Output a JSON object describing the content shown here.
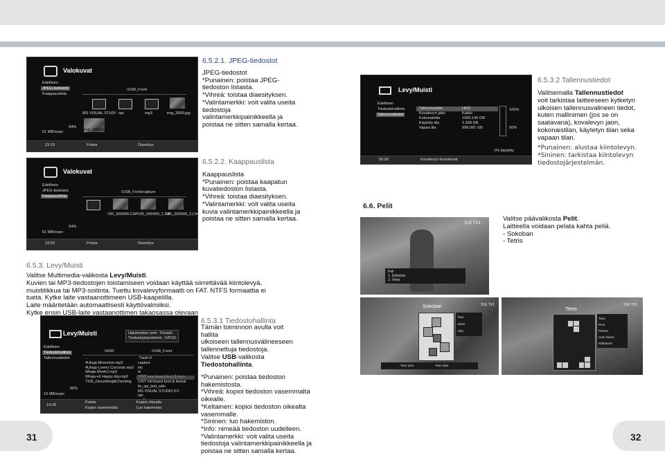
{
  "left": {
    "s1_heading": "6.5.2.1. JPEG-tiedostot",
    "s1_text": "JPEG-tiedostot\n*Punainen: poistaa JPEG-\ntiedoston listasta.\n*Vihreä: toistaa diaesityksen.\n*Valintamerkki: voit valita useita\ntiedostoja\nvalintamerkkipainikkeella ja\npoistaa ne sitten samalla kertaa.",
    "s2_heading": "6.5.2.2. Kaappauslista",
    "s2_text": "Kaappauslista\n*Punainen: poistaa kaapatun\nkuvatiedoston listasta.\n*Vihreä: toistaa diaesityksen.\n*Valintamerkki: voit valita useita\nkuvia valintamerkkipainikkeella ja\npoistaa ne sitten samalla kertaa.",
    "s3_heading": "6.5.3. Levy/Muisti",
    "s3_l1_pre": "Valitse Multimedia-valikosta ",
    "s3_l1_bold": "Levy/Muisti",
    "s3_l1_post": ".",
    "s3_rest": "Kuvien tai MP3-tiedostojen toistamiseen voidaan käyttää siirrettävää kiintolevyä,\nmuistitikkua tai MP3-soitinta. Tuettu kovalevyformaatti on FAT. NTFS formaattia ei\ntueta. Kytke laite vastaanottimeen USB-kaapelilla.\nLaite määritetään automaattisesti käyttövalmiiksi.\nKytke ensin USB-laite vastaanottimen takaosassa olevaan",
    "s4_heading": "6.5.3.1 Tiedostohallinta",
    "s4_l1": "Tämän toiminnon avulla voit\nhallita\nulkoiseen tallennusvälineeseen\ntallennettuja tiedostoja.",
    "s4_l2_pre": "Valitse ",
    "s4_l2_bold": "USB",
    "s4_l2_post": "-valikosta",
    "s4_l3_bold": "Tiedostohallinta",
    "s4_l3_post": ".",
    "s4_rest": "*Punainen: poistaa tiedoston\nhakemistosta.\n*Vihreä: kopioi tiedoston vasemmalta\noikealle.\n*Keltainen: kopioi tiedoston oikealta\n  vasemmalle.\n*Sininen: luo hakemiston.\n*Info: nimeää tiedoston uudelleen.\n*Valintamerkki: voit valita useita\ntiedostoja valintamerkkipainikkeella ja\npoistaa ne sitten samalla kertaa.",
    "page": "31"
  },
  "right": {
    "s1_heading": "6.5.3.2 Tallennustiedot",
    "s1_pre": "Valitsemalla ",
    "s1_bold": "Tallennustiedot",
    "s1_text": "voit tarkistaa laitteeseen kytketyn\nulkoisen tallennusvalineen tiedot,\nkuten mallinimen (jos se on\nsaatavana), kovalevyn jaon,\nkokonaistilan, käytetyn tilan seka\nvapaan tilan.",
    "s1_keys": "*Punainen: alustaa kiintolevyn.\n*Sininen: tarkistaa kiintolevyn\ntiedostojärjestelmän.",
    "s2_heading": "6.6. Pelit",
    "s2_l1_pre": "Valitse päävalikosta ",
    "s2_l1_bold": "Pelit",
    "s2_l1_post": ".",
    "s2_rest": "Laitteella voidaan pelata kahta peliä.\n - Sokoban\n - Tetris",
    "page": "32"
  },
  "shots": {
    "valokuvat": {
      "title": "Valokuvat",
      "menu": [
        "Edellinen",
        "JPEG-tiedostot",
        "Kaappauslista"
      ],
      "path": "/USB_Front",
      "files": [
        "MS VISUAL STUDI",
        "opt",
        "mp3",
        "img_3969.jpg"
      ],
      "usage": "94%",
      "speed": "61 MB/sopo",
      "time": "23:19",
      "red": "Poista",
      "green": "Diaesitys",
      "thumb": "img_3969.jpg"
    },
    "kaappaus": {
      "title": "Valokuvat",
      "menu": [
        "Edellinen",
        "JPEG-tiedostot",
        "Kaappauslista"
      ],
      "path": "/USB_Front/capture",
      "files": [
        "VID_000000.CAP",
        "VID_000000_1.CA",
        "VID_000000_2.CA"
      ],
      "usage": "94%",
      "speed": "61 MB/sopo",
      "time": "23:20",
      "red": "Poista",
      "green": "Diaesitys"
    },
    "levy": {
      "title": "Levy/Muisti",
      "menu": [
        "Edellinen",
        "Tiedostohallinta",
        "Tallennustiedot"
      ],
      "info": "Hakemiston nimi : Finnish\nTiedostojärjestelmä : FAT32",
      "left_path": "/HDD",
      "right_path": "/USB_Front",
      "left_files": "..\n4Ukaja-Moonriver.mp3\n4Ukaja-Lovers Concerto.mp3\nWkaja-Shrek2.mp3\nWkaja-eh Happy day.mp3\n7105_Describing&Checking",
      "right_files": ".Trash-0\ncapture\netc\nei\n126T new board boot & kern\n126T old board boot & kernal\nfw_spi_test_sdio\nMS VISUAL STUDIO 6.0\nopt\nmp3",
      "usage": "96%",
      "speed": "10 MB/sopo",
      "time": "14:28",
      "red": "Poista",
      "green": "Kopioi vasemmalla",
      "yellow": "Kopioi oikealla",
      "blue": "Luo hakemisto"
    },
    "tallennus": {
      "title": "Levy/Muisti",
      "menu": [
        "Edellinen",
        "Tiedostohallinta",
        "Tallennustiedot"
      ],
      "table": "Tallennuslaite\nKovalevyn jako\nKokonaistila\nKäytetty tila\nVapaa tila",
      "values": "HDD\nKaikki\n1000.140 GB\n2.398 GB\n998.081 GB",
      "pct1": "100%",
      "pct2": "50%",
      "used": "1% käytetty",
      "time": "06:00",
      "red": "Kovalevyn formatointi"
    },
    "pelit": {
      "channel": "YLE TV1",
      "menu": "Peli\n1. Sokoban\n2. Tetris"
    },
    "sokoban": {
      "title": "Sokoban",
      "stats": "Taso\nAskel\nAika",
      "exit": "Taso ylös",
      "next": "Taso alas",
      "channel": "YLE TV1"
    },
    "tetris": {
      "title": "Tetris",
      "stats": "Taso\nRivit\nPisteet\nUusi status\nNähtävää",
      "channel": "YLE TV1"
    }
  }
}
